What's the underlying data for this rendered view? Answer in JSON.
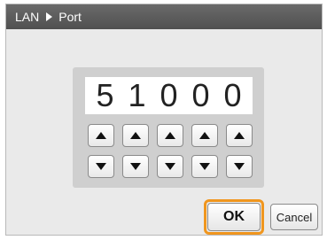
{
  "titlebar": {
    "crumb_parent": "LAN",
    "crumb_current": "Port",
    "separator_icon": "triangle-right-icon"
  },
  "port_editor": {
    "digits": [
      "5",
      "1",
      "0",
      "0",
      "0"
    ],
    "up_icon": "triangle-up-icon",
    "down_icon": "triangle-down-icon"
  },
  "footer": {
    "ok_label": "OK",
    "cancel_label": "Cancel"
  },
  "colors": {
    "titlebar_bg": "#555555",
    "dialog_bg": "#eaeaea",
    "panel_bg": "#cfcfcf",
    "focus_outline": "#f0961e"
  }
}
